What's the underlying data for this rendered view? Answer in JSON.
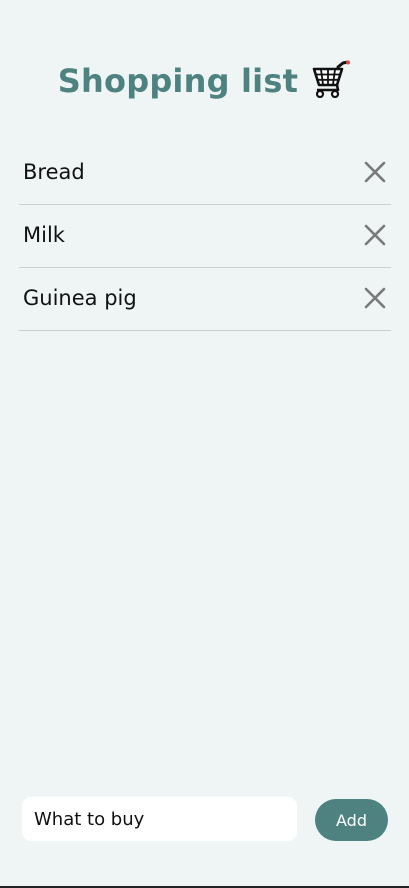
{
  "header": {
    "title": "Shopping list",
    "cart_icon": "shopping-cart-icon"
  },
  "list": {
    "items": [
      {
        "label": "Bread",
        "remove_icon": "close-icon"
      },
      {
        "label": "Milk",
        "remove_icon": "close-icon"
      },
      {
        "label": "Guinea pig",
        "remove_icon": "close-icon"
      }
    ]
  },
  "form": {
    "input_placeholder": "What to buy",
    "input_value": "",
    "add_label": "Add"
  },
  "colors": {
    "background": "#eef5f4",
    "accent": "#4d8280",
    "divider": "#c9cfcf",
    "icon": "#7a7a7a"
  }
}
